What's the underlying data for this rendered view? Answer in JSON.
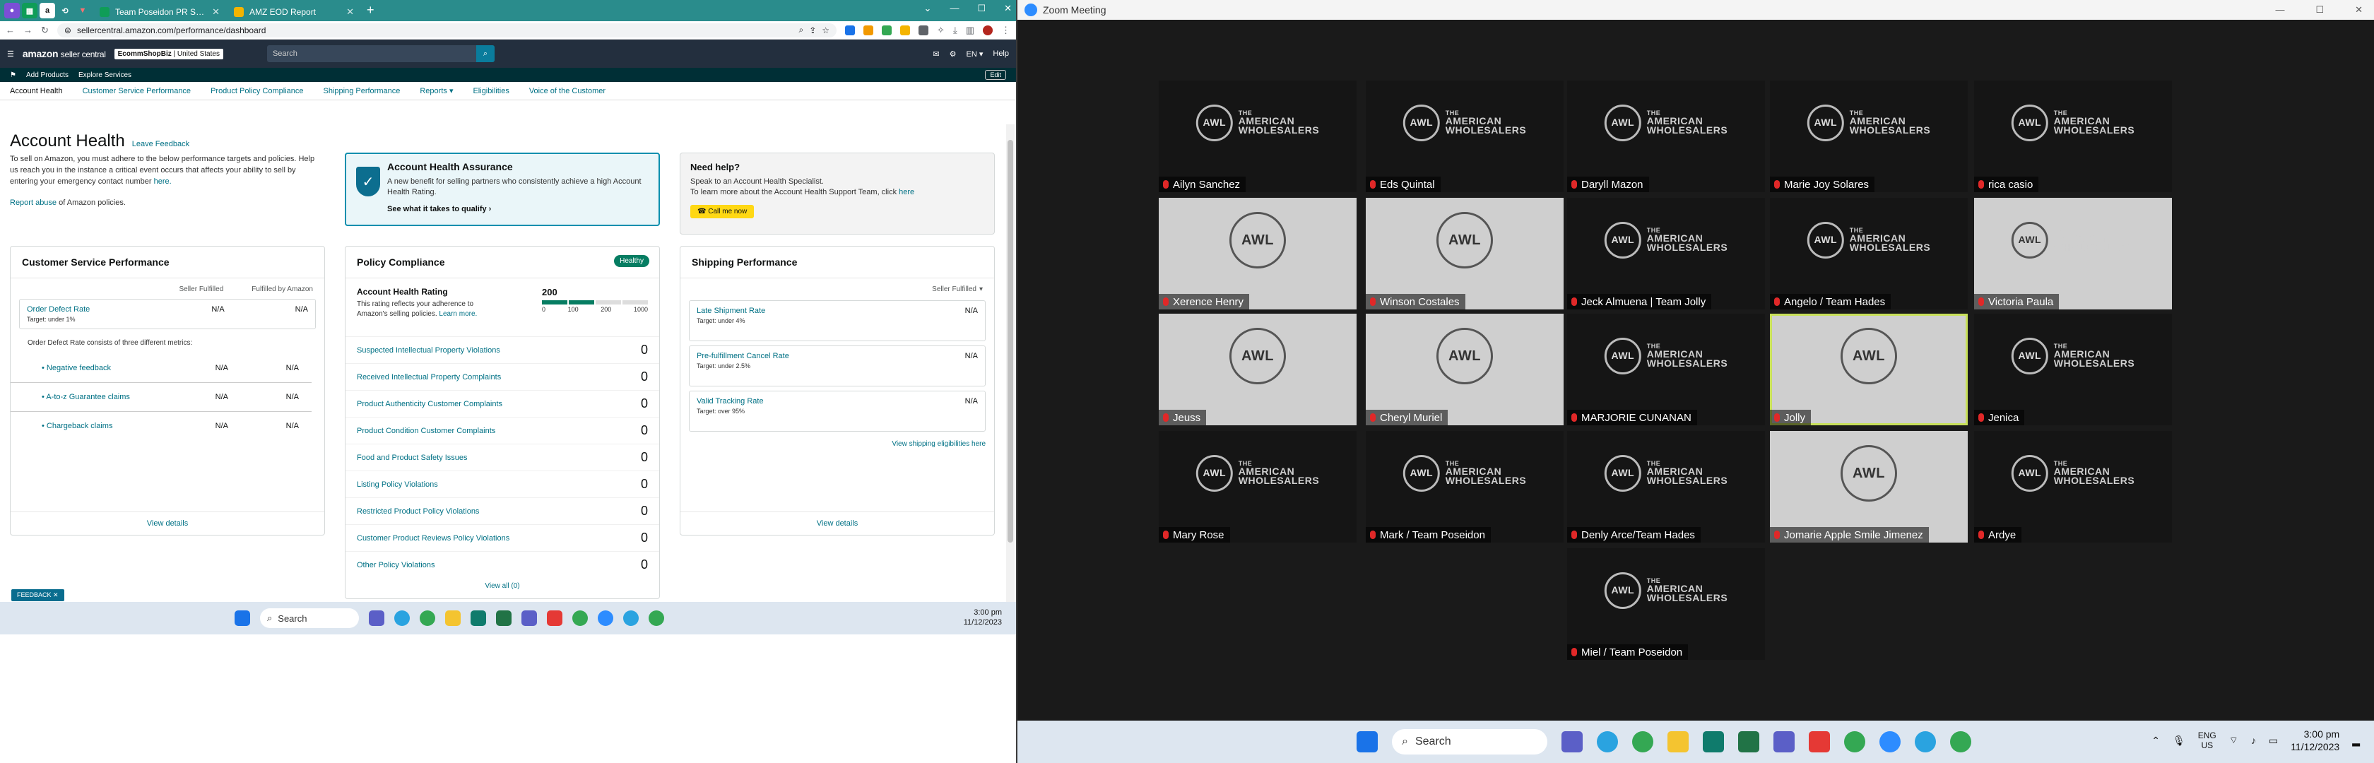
{
  "browser": {
    "tabs": [
      {
        "title": "Team Poseidon PR Sheet - Goo",
        "favicon_color": "#0f9d58",
        "active": false
      },
      {
        "title": "AMZ EOD Report",
        "favicon_color": "#f4b400",
        "active": false
      }
    ],
    "url": "sellercentral.amazon.com/performance/dashboard"
  },
  "seller_nav": {
    "logo": "amazon",
    "logo_suffix": "seller central",
    "account_name": "EcommShopBiz",
    "account_region": "United States",
    "search_placeholder": "Search",
    "language": "EN",
    "help": "Help",
    "quick_links": [
      "Add Products",
      "Explore Services"
    ],
    "edit": "Edit",
    "tabs": [
      "Account Health",
      "Customer Service Performance",
      "Product Policy Compliance",
      "Shipping Performance",
      "Reports",
      "Eligibilities",
      "Voice of the Customer"
    ]
  },
  "page": {
    "title": "Account Health",
    "feedback_link": "Leave Feedback",
    "intro": "To sell on Amazon, you must adhere to the below performance targets and policies. Help us reach you in the instance a critical event occurs that affects your ability to sell by entering your emergency contact number",
    "intro_link": "here.",
    "report_abuse": "Report abuse",
    "report_abuse_suffix": "of Amazon policies."
  },
  "aha": {
    "title": "Account Health Assurance",
    "text": "A new benefit for selling partners who consistently achieve a high Account Health Rating.",
    "link": "See what it takes to qualify"
  },
  "help_box": {
    "title": "Need help?",
    "line1": "Speak to an Account Health Specialist.",
    "line2": "To learn more about the Account Health Support Team, click",
    "line2_link": "here",
    "button": "Call me now"
  },
  "csp": {
    "title": "Customer Service Performance",
    "col1": "Seller Fulfilled",
    "col2": "Fulfilled by Amazon",
    "odr_name": "Order Defect Rate",
    "odr_target": "Target: under 1%",
    "odr_v1": "N/A",
    "odr_v2": "N/A",
    "note": "Order Defect Rate consists of three different metrics:",
    "sub": [
      {
        "name": "Negative feedback",
        "v1": "N/A",
        "v2": "N/A"
      },
      {
        "name": "A-to-z Guarantee claims",
        "v1": "N/A",
        "v2": "N/A"
      },
      {
        "name": "Chargeback claims",
        "v1": "N/A",
        "v2": "N/A"
      }
    ],
    "view": "View details"
  },
  "pc": {
    "title": "Policy Compliance",
    "badge": "Healthy",
    "ahr_title": "Account Health Rating",
    "ahr_text": "This rating reflects your adherence to Amazon's selling policies.",
    "ahr_link": "Learn more.",
    "score": "200",
    "score_level": 200,
    "scale": [
      "0",
      "100",
      "200",
      "1000"
    ],
    "violations": [
      {
        "name": "Suspected Intellectual Property Violations",
        "count": "0"
      },
      {
        "name": "Received Intellectual Property Complaints",
        "count": "0"
      },
      {
        "name": "Product Authenticity Customer Complaints",
        "count": "0"
      },
      {
        "name": "Product Condition Customer Complaints",
        "count": "0"
      },
      {
        "name": "Food and Product Safety Issues",
        "count": "0"
      },
      {
        "name": "Listing Policy Violations",
        "count": "0"
      },
      {
        "name": "Restricted Product Policy Violations",
        "count": "0"
      },
      {
        "name": "Customer Product Reviews Policy Violations",
        "count": "0"
      },
      {
        "name": "Other Policy Violations",
        "count": "0"
      }
    ],
    "view_all": "View all (0)"
  },
  "sp": {
    "title": "Shipping Performance",
    "filter": "Seller Fulfilled",
    "metrics": [
      {
        "name": "Late Shipment Rate",
        "target": "Target: under 4%",
        "value": "N/A"
      },
      {
        "name": "Pre-fulfillment Cancel Rate",
        "target": "Target: under 2.5%",
        "value": "N/A"
      },
      {
        "name": "Valid Tracking Rate",
        "target": "Target: over 95%",
        "value": "N/A"
      }
    ],
    "elig_link": "View shipping eligibilities here",
    "view": "View details"
  },
  "feedback_tab": "FEEDBACK",
  "left_taskbar": {
    "search": "Search",
    "time": "3:00 pm",
    "date": "11/12/2023"
  },
  "zoom": {
    "title": "Zoom Meeting",
    "brand_line1": "THE",
    "brand_line2": "AMERICAN",
    "brand_line3": "WHOLESALERS",
    "brand_mark": "AWL",
    "participants": [
      "Ailyn Sanchez",
      "Eds Quintal",
      "Daryll Mazon",
      "Marie Joy Solares",
      "rica casio",
      "Xerence Henry",
      "Winson Costales",
      "Jeck Almuena | Team Jolly",
      "Angelo / Team Hades",
      "Victoria Paula",
      "Jeuss",
      "Cheryl Muriel",
      "MARJORIE CUNANAN",
      "Jolly",
      "Jenica",
      "Mary Rose",
      "Mark / Team Poseidon",
      "Denly Arce/Team Hades",
      "Jomarie Apple Smile Jimenez",
      "Ardye",
      "Miel / Team Poseidon"
    ]
  },
  "right_taskbar": {
    "search": "Search",
    "lang1": "ENG",
    "lang2": "US",
    "time": "3:00 pm",
    "date": "11/12/2023"
  }
}
